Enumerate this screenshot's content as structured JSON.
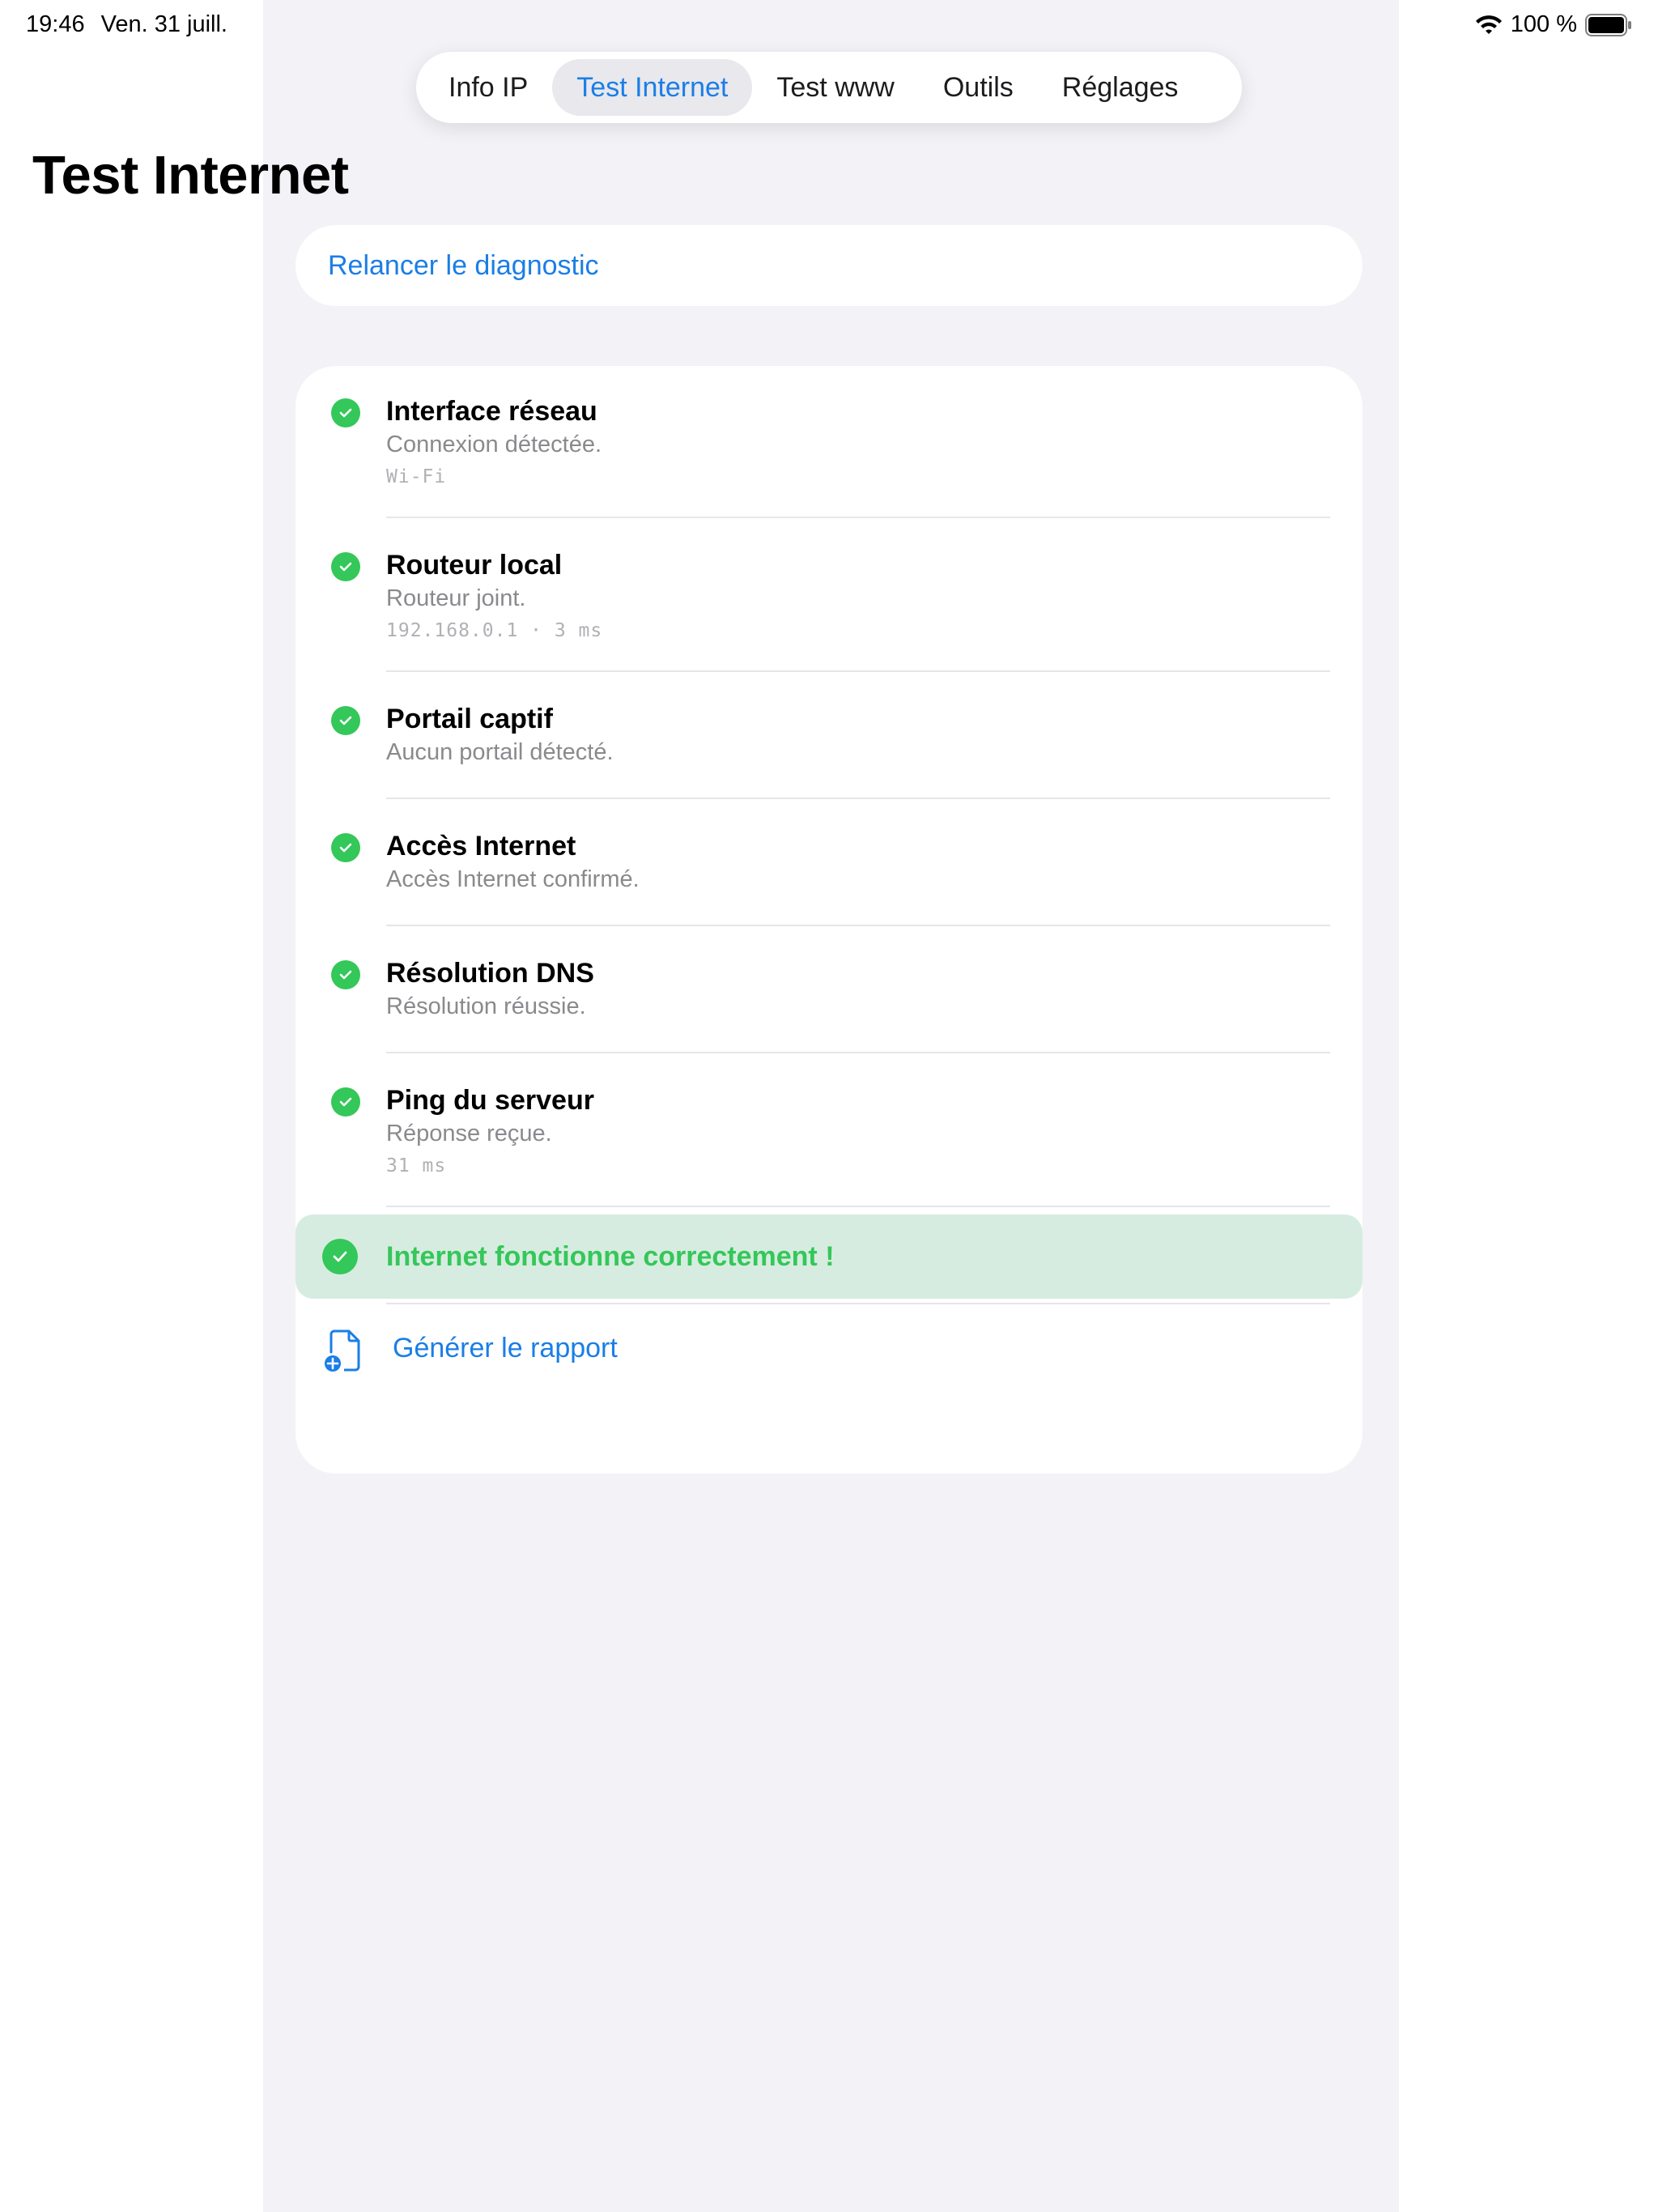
{
  "status_bar": {
    "time": "19:46",
    "date": "Ven. 31 juill.",
    "battery": "100 %"
  },
  "tabs": [
    {
      "label": "Info IP",
      "active": false
    },
    {
      "label": "Test Internet",
      "active": true
    },
    {
      "label": "Test www",
      "active": false
    },
    {
      "label": "Outils",
      "active": false
    },
    {
      "label": "Réglages",
      "active": false
    }
  ],
  "page": {
    "title": "Test Internet",
    "rerun_label": "Relancer le diagnostic"
  },
  "checks": [
    {
      "title": "Interface réseau",
      "subtitle": "Connexion détectée.",
      "detail": "Wi-Fi",
      "status": "ok"
    },
    {
      "title": "Routeur local",
      "subtitle": "Routeur joint.",
      "detail": "192.168.0.1 · 3 ms",
      "status": "ok"
    },
    {
      "title": "Portail captif",
      "subtitle": "Aucun portail détecté.",
      "detail": "",
      "status": "ok"
    },
    {
      "title": "Accès Internet",
      "subtitle": "Accès Internet confirmé.",
      "detail": "",
      "status": "ok"
    },
    {
      "title": "Résolution DNS",
      "subtitle": "Résolution réussie.",
      "detail": "",
      "status": "ok"
    },
    {
      "title": "Ping du serveur",
      "subtitle": "Réponse reçue.",
      "detail": "31 ms",
      "status": "ok"
    }
  ],
  "result": {
    "message": "Internet fonctionne correctement !"
  },
  "report": {
    "label": "Générer le rapport"
  },
  "colors": {
    "accent": "#1a7ee6",
    "success": "#34c759",
    "success_bg": "#d7ece0",
    "grouped_bg": "#f2f2f7"
  }
}
